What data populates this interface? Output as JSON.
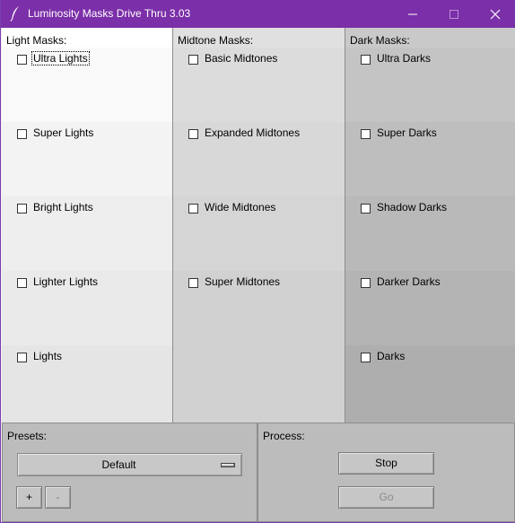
{
  "window": {
    "title": "Luminosity Masks Drive Thru 3.03",
    "accent": "#7b2fa8"
  },
  "light": {
    "heading": "Light Masks:",
    "items": [
      {
        "label": "Ultra Lights",
        "checked": false
      },
      {
        "label": "Super Lights",
        "checked": false
      },
      {
        "label": "Bright Lights",
        "checked": false
      },
      {
        "label": "Lighter Lights",
        "checked": false
      },
      {
        "label": "Lights",
        "checked": false
      }
    ]
  },
  "midtone": {
    "heading": "Midtone Masks:",
    "items": [
      {
        "label": "Basic Midtones",
        "checked": false
      },
      {
        "label": "Expanded Midtones",
        "checked": false
      },
      {
        "label": "Wide Midtones",
        "checked": false
      },
      {
        "label": "Super Midtones",
        "checked": false
      }
    ]
  },
  "dark": {
    "heading": "Dark Masks:",
    "items": [
      {
        "label": "Ultra Darks",
        "checked": false
      },
      {
        "label": "Super Darks",
        "checked": false
      },
      {
        "label": "Shadow Darks",
        "checked": false
      },
      {
        "label": "Darker Darks",
        "checked": false
      },
      {
        "label": "Darks",
        "checked": false
      }
    ]
  },
  "presets": {
    "heading": "Presets:",
    "selected": "Default",
    "add_label": "+",
    "remove_label": "-"
  },
  "process": {
    "heading": "Process:",
    "stop_label": "Stop",
    "go_label": "Go"
  },
  "icons": {
    "app": "feather-icon",
    "minimize": "minimize-icon",
    "maximize": "maximize-icon",
    "close": "close-icon"
  }
}
